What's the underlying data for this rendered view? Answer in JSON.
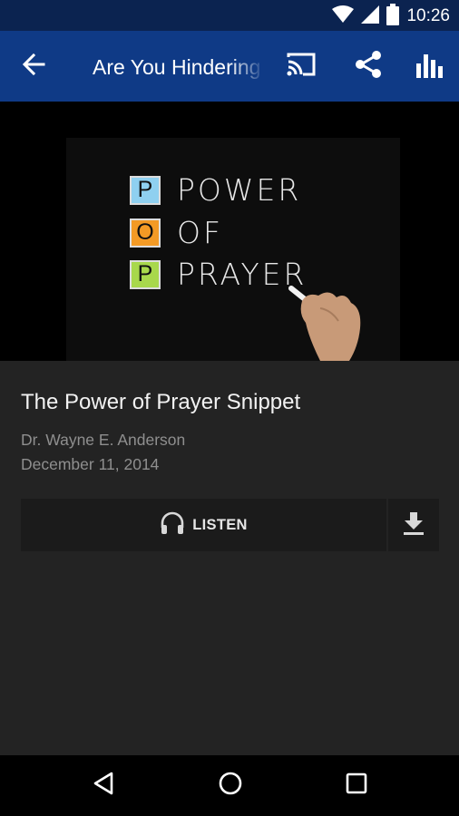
{
  "status_bar": {
    "time": "10:26",
    "icons": [
      "wifi-icon",
      "cell-signal-icon",
      "battery-icon"
    ]
  },
  "app_bar": {
    "title": "Are You Hindering",
    "icons": [
      "back-arrow-icon",
      "cast-icon",
      "share-icon",
      "bar-chart-icon"
    ],
    "background": "#0f3a86"
  },
  "artwork": {
    "rows": [
      {
        "letter": "P",
        "word": "POWER",
        "color": "#8fd0f0"
      },
      {
        "letter": "O",
        "word": "OF",
        "color": "#f39a25"
      },
      {
        "letter": "P",
        "word": "PRAYER",
        "color": "#a8d84c"
      }
    ]
  },
  "episode": {
    "title": "The Power of Prayer Snippet",
    "author": "Dr. Wayne E. Anderson",
    "date": "December 11, 2014"
  },
  "actions": {
    "listen_label": "LISTEN",
    "listen_icon": "headphones-icon",
    "download_icon": "download-icon"
  },
  "nav_bar": {
    "icons": [
      "nav-back-icon",
      "nav-home-icon",
      "nav-recents-icon"
    ]
  }
}
